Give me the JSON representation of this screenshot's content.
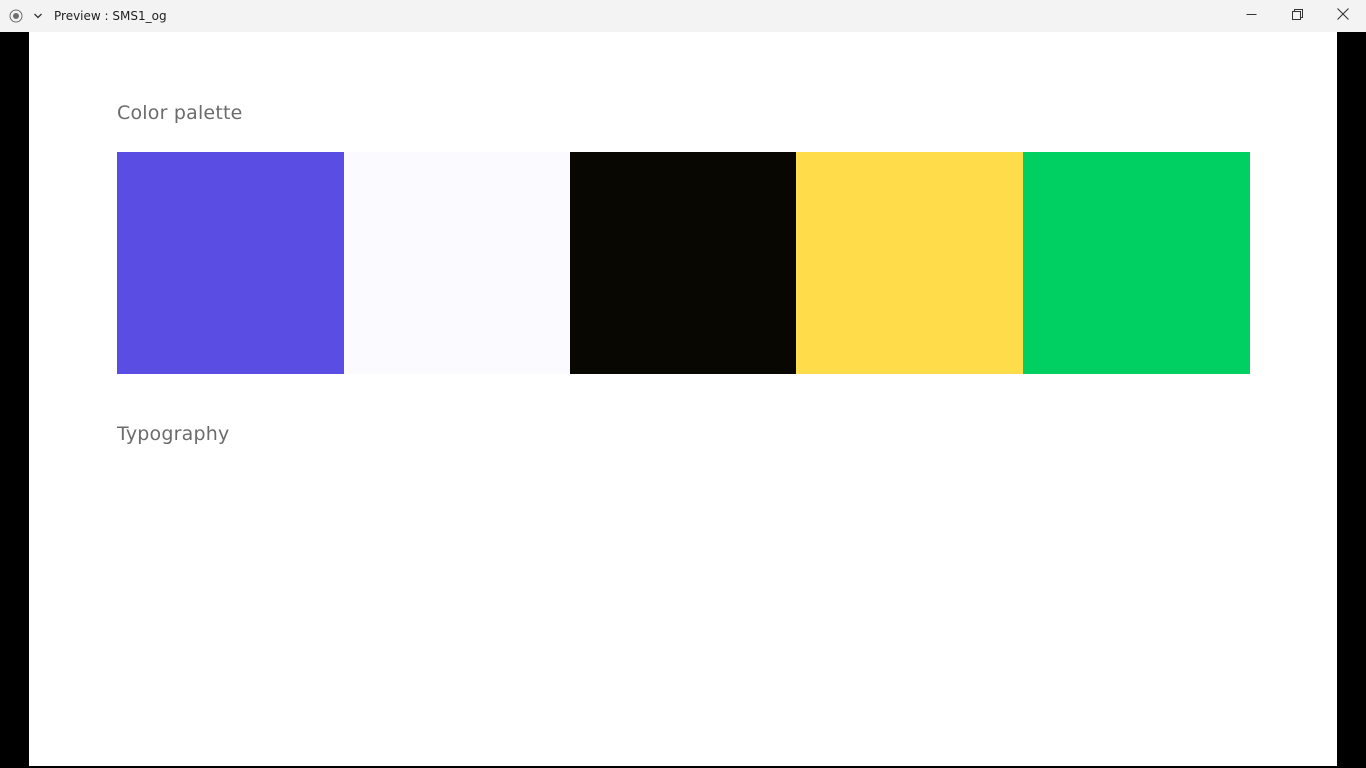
{
  "window": {
    "title": "Preview : SMS1_og",
    "icons": {
      "app": "record-icon",
      "menu": "chevron-down-icon",
      "minimize": "minimize-icon",
      "restore": "restore-icon",
      "close": "close-icon"
    }
  },
  "sections": {
    "palette_title": "Color palette",
    "typography_title": "Typography"
  },
  "palette": {
    "swatches": [
      {
        "color": "#5a4de3"
      },
      {
        "color": "#fbfaff"
      },
      {
        "color": "#080701"
      },
      {
        "color": "#ffdd4a"
      },
      {
        "color": "#00cf62"
      }
    ]
  }
}
